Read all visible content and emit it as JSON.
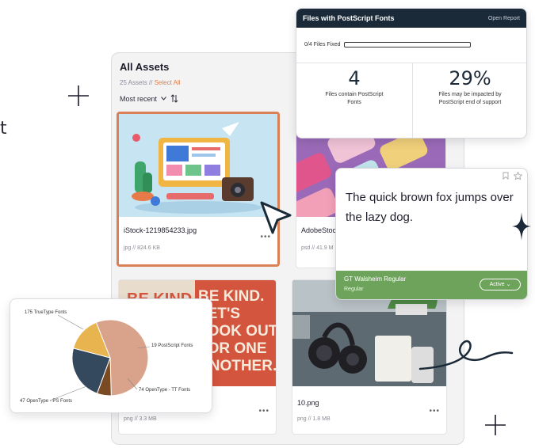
{
  "edge_letter": "t",
  "assets": {
    "title": "All Assets",
    "count": "25 Assets //",
    "select_all": "Select All",
    "sort": "Most recent",
    "cards": [
      {
        "name": "iStock-1219854233.jpg",
        "info": "jpg // 824.6 KB",
        "selected": true
      },
      {
        "name": "AdobeStoc",
        "info": "psd // 41.9 M",
        "selected": false
      },
      {
        "name": "",
        "info": "png // 3.3 MB",
        "selected": false
      },
      {
        "name": "10.png",
        "info": "png // 1.8 MB",
        "selected": false
      }
    ],
    "poster_lines": [
      "BE KIND.",
      "LET'S",
      "LOOK OUT",
      "FOR ONE",
      "ANOTHER."
    ],
    "poster_left": "BE KIND"
  },
  "report": {
    "title": "Files with PostScript Fonts",
    "link": "Open Report",
    "fixed_label": "0/4 Files Fixed",
    "fixed_progress": 0,
    "stat1_value": "4",
    "stat1_desc": "Files contain PostScript Fonts",
    "stat2_value": "29%",
    "stat2_desc": "Files may be impacted by PostScript end of support"
  },
  "font_card": {
    "sample": "The quick brown fox jumps over the lazy dog.",
    "font_name": "GT Walsheim Regular",
    "style": "Regular",
    "status": "Active"
  },
  "chart_data": {
    "type": "pie",
    "slices": [
      {
        "label": "175 TrueType Fonts",
        "value": 175,
        "color": "#d9a28a"
      },
      {
        "label": "19 PostScript Fonts",
        "value": 19,
        "color": "#7a4a22"
      },
      {
        "label": "74 OpenType - TT Fonts",
        "value": 74,
        "color": "#34495e"
      },
      {
        "label": "47 OpenType - PS Fonts",
        "value": 47,
        "color": "#e8b450"
      }
    ]
  },
  "colors": {
    "accent": "#d98057",
    "report_header": "#1b2a38",
    "font_footer": "#6ea35c"
  },
  "icons": [
    "sparkle-icon",
    "chevron-down-icon",
    "sort-icon",
    "more-icon",
    "cursor-arrow-icon",
    "bookmark-icon",
    "star-icon"
  ]
}
